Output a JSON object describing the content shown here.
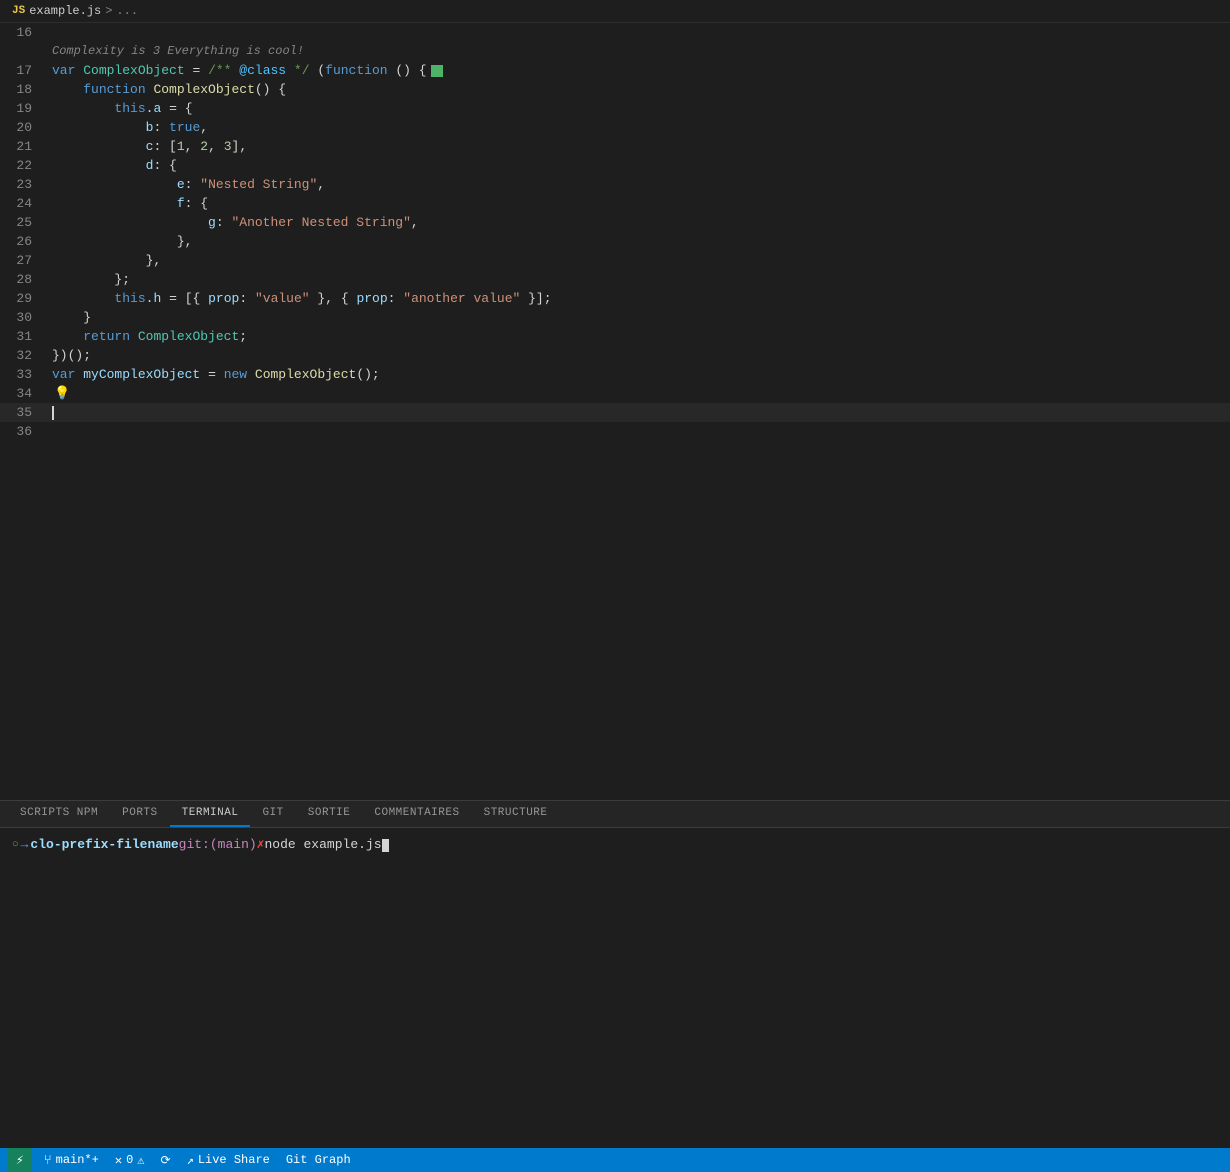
{
  "breadcrumb": {
    "filename": "example.js",
    "separator": ">",
    "rest": "..."
  },
  "editor": {
    "lines": [
      {
        "num": 16,
        "content": ""
      },
      {
        "num": 16,
        "type": "info",
        "text": "Complexity is 3 Everything is cool!"
      },
      {
        "num": 17,
        "code": "var ComplexObject = /** @class */ (function () {",
        "hasGreenBox": true
      },
      {
        "num": 18,
        "code": "    function ComplexObject() {"
      },
      {
        "num": 19,
        "code": "        this.a = {"
      },
      {
        "num": 20,
        "code": "            b: true,"
      },
      {
        "num": 21,
        "code": "            c: [1, 2, 3],"
      },
      {
        "num": 22,
        "code": "            d: {"
      },
      {
        "num": 23,
        "code": "                e: \"Nested String\","
      },
      {
        "num": 24,
        "code": "                f: {"
      },
      {
        "num": 25,
        "code": "                    g: \"Another Nested String\","
      },
      {
        "num": 26,
        "code": "                },"
      },
      {
        "num": 27,
        "code": "            },"
      },
      {
        "num": 28,
        "code": "        };"
      },
      {
        "num": 29,
        "code": "        this.h = [{ prop: \"value\" }, { prop: \"another value\" }];"
      },
      {
        "num": 30,
        "code": "    }"
      },
      {
        "num": 31,
        "code": "    return ComplexObject;"
      },
      {
        "num": 32,
        "code": "})();"
      },
      {
        "num": 33,
        "code": "var myComplexObject = new ComplexObject();"
      },
      {
        "num": 34,
        "hasLightbulb": true
      },
      {
        "num": 35,
        "isCursor": true
      },
      {
        "num": 36,
        "code": ""
      }
    ]
  },
  "panel": {
    "tabs": [
      {
        "label": "SCRIPTS NPM",
        "active": false
      },
      {
        "label": "PORTS",
        "active": false
      },
      {
        "label": "TERMINAL",
        "active": true
      },
      {
        "label": "GIT",
        "active": false
      },
      {
        "label": "SORTIE",
        "active": false
      },
      {
        "label": "COMMENTAIRES",
        "active": false
      },
      {
        "label": "STRUCTURE",
        "active": false
      }
    ],
    "terminal": {
      "prompt_dir": "clo-prefix-filename",
      "prompt_git": "git:(main)",
      "prompt_cross": "✗",
      "command": "node example.js"
    }
  },
  "statusbar": {
    "remote_label": "⚡",
    "branch_icon": "⑂",
    "branch": "main*+",
    "errors": "0",
    "sync_icon": "⟳",
    "liveshare_icon": "↗",
    "liveshare_label": "Live Share",
    "gitgraph_label": "Git Graph"
  }
}
